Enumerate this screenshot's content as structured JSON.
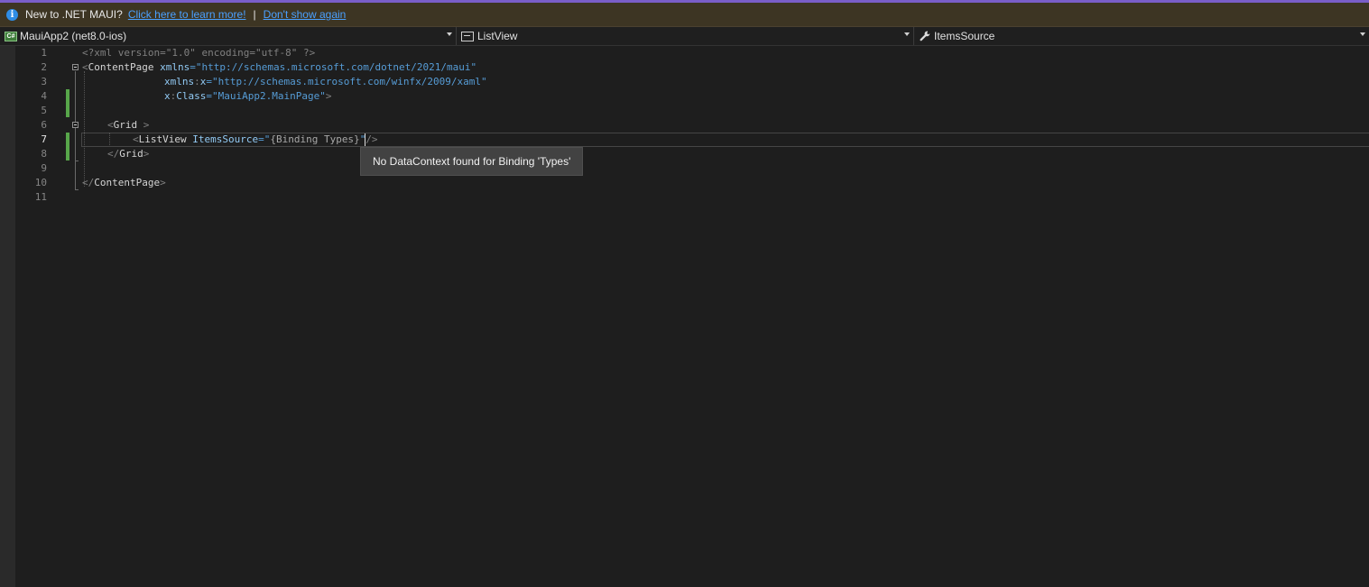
{
  "infobar": {
    "message": "New to .NET MAUI?",
    "learn_link": "Click here to learn more!",
    "separator": "|",
    "dismiss_link": "Don't show again"
  },
  "navbar": {
    "project": "MauiApp2 (net8.0-ios)",
    "type": "ListView",
    "member": "ItemsSource"
  },
  "editor": {
    "active_line": 7,
    "line_numbers": [
      "1",
      "2",
      "3",
      "4",
      "5",
      "6",
      "7",
      "8",
      "9",
      "10",
      "11"
    ],
    "lines": {
      "l1": "<?xml version=\"1.0\" encoding=\"utf-8\" ?>",
      "l2": {
        "open": "<",
        "element": "ContentPage",
        "attr": "xmlns",
        "eq": "=",
        "value": "\"http://schemas.microsoft.com/dotnet/2021/maui\""
      },
      "l3": {
        "prefix": "xmlns",
        "colon": ":",
        "attr": "x",
        "eq": "=",
        "value": "\"http://schemas.microsoft.com/winfx/2009/xaml\""
      },
      "l4": {
        "prefix": "x",
        "colon": ":",
        "attr": "Class",
        "eq": "=",
        "value": "\"MauiApp2.MainPage\"",
        "close": ">"
      },
      "l6": {
        "open": "<",
        "element": "Grid",
        "close": " >"
      },
      "l7": {
        "open": "<",
        "element": "ListView",
        "attr": "ItemsSource",
        "eq": "=",
        "quote_open": "\"",
        "binding": "{Binding Types}",
        "quote_close": "\"",
        "close": "/>"
      },
      "l8": {
        "open": "</",
        "element": "Grid",
        "close": ">"
      },
      "l10": {
        "open": "</",
        "element": "ContentPage",
        "close": ">"
      }
    }
  },
  "tooltip": {
    "text": "No DataContext found for Binding 'Types'"
  },
  "colors": {
    "infobar_bg": "#3d3523",
    "link": "#4aa0ff",
    "editor_bg": "#1e1e1e",
    "change_marker": "#57a64a",
    "string": "#569cd6",
    "attribute": "#92caf4"
  }
}
